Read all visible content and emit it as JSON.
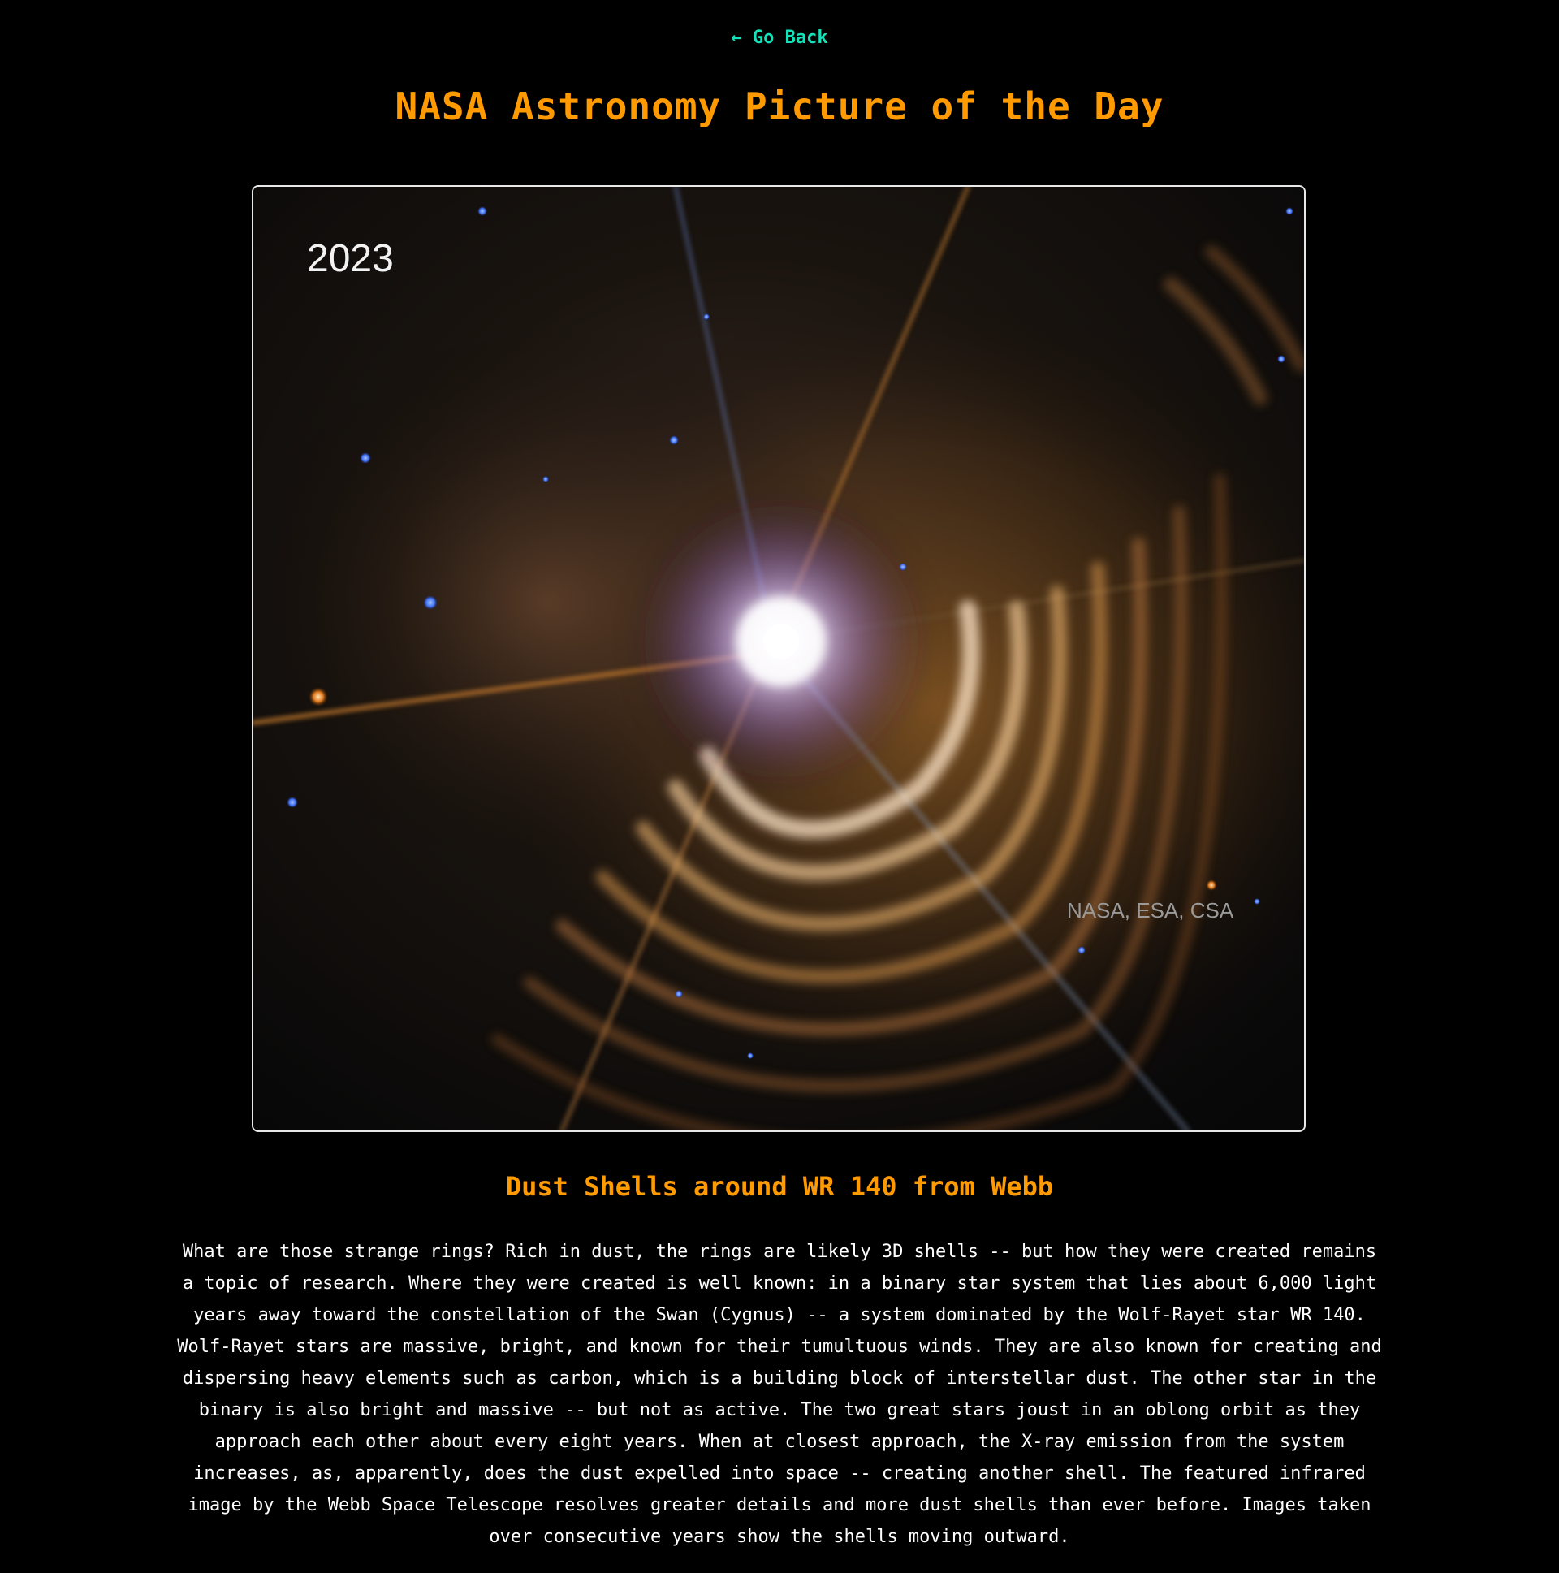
{
  "nav": {
    "back_label": "← Go Back"
  },
  "header": {
    "title": "NASA Astronomy Picture of the Day"
  },
  "apod": {
    "image": {
      "year_label": "2023",
      "credit_label": "NASA, ESA, CSA"
    },
    "title": "Dust Shells around WR 140 from Webb",
    "explanation": "What are those strange rings? Rich in dust, the rings are likely 3D shells -- but how they were created remains a topic of research. Where they were created is well known: in a binary star system that lies about 6,000 light years away toward the constellation of the Swan (Cygnus) -- a system dominated by the Wolf-Rayet star WR 140. Wolf-Rayet stars are massive, bright, and known for their tumultuous winds. They are also known for creating and dispersing heavy elements such as carbon, which is a building block of interstellar dust. The other star in the binary is also bright and massive -- but not as active. The two great stars joust in an oblong orbit as they approach each other about every eight years. When at closest approach, the X-ray emission from the system increases, as, apparently, does the dust expelled into space -- creating another shell. The featured infrared image by the Webb Space Telescope resolves greater details and more dust shells than ever before. Images taken over consecutive years show the shells moving outward."
  },
  "colors": {
    "background": "#000000",
    "accent_title": "#ff9a00",
    "link": "#14e0b9",
    "body_text": "#ffffff",
    "frame_border": "#e8e8e8"
  }
}
